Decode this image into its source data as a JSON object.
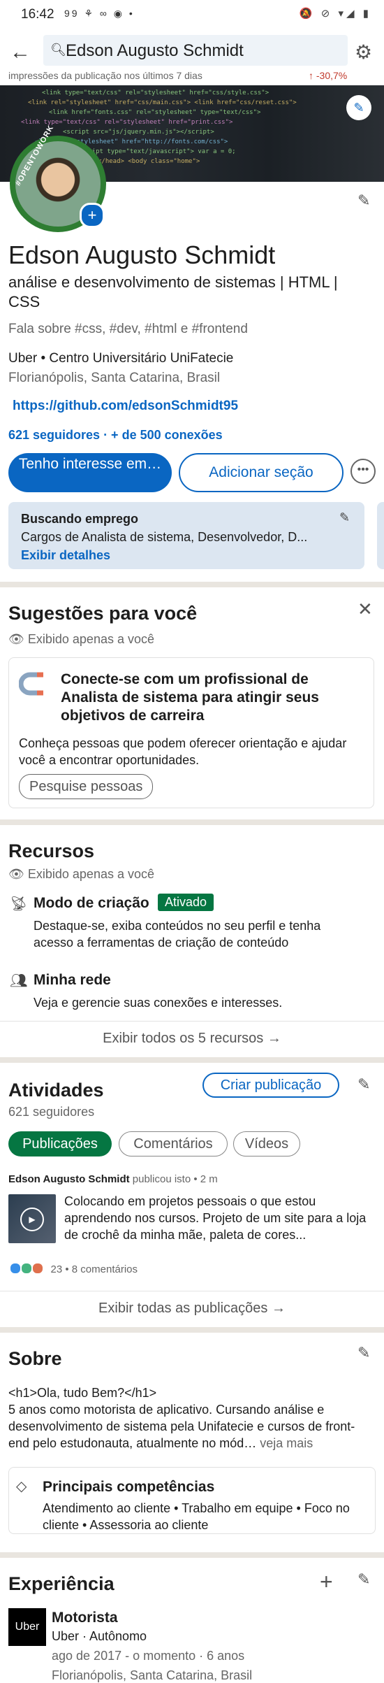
{
  "status_bar": {
    "time": "16:42",
    "left_icons": "99 ⚘ ∞ ◉ •",
    "right_icons": "🔕 ⊘ ▾◢ ▮"
  },
  "search": {
    "query": "Edson Augusto Schmidt"
  },
  "banner": {
    "cut_text": "impressões da publicação nos últimos 7 dias",
    "cut_pct": "↑ -30,7%"
  },
  "profile": {
    "open_to_work_label": "#OPENTOWORK",
    "name": "Edson Augusto Schmidt",
    "headline": "análise e desenvolvimento de sistemas | HTML | CSS",
    "talks_about": "Fala sobre #css, #dev, #html e #frontend",
    "company": "Uber • Centro Universitário UniFatecie",
    "location": "Florianópolis, Santa Catarina, Brasil",
    "link": "https://github.com/edsonSchmidt95",
    "followers": "621 seguidores · + de 500 conexões",
    "btn_interest": "Tenho interesse em…",
    "btn_add_section": "Adicionar seção",
    "btn_more": "•••"
  },
  "open_to_work_card": {
    "title": "Buscando emprego",
    "desc": "Cargos de Analista de sistema, Desenvolvedor, D...",
    "link": "Exibir detalhes"
  },
  "suggestions": {
    "title": "Sugestões para você",
    "private": "Exibido apenas a você",
    "card_title": "Conecte-se com um profissional de Analista de sistema para atingir seus objetivos de carreira",
    "card_desc": "Conheça pessoas que podem oferecer orientação e ajudar você a encontrar oportunidades.",
    "card_btn": "Pesquise pessoas"
  },
  "resources": {
    "title": "Recursos",
    "private": "Exibido apenas a você",
    "items": [
      {
        "title": "Modo de criação",
        "badge": "Ativado",
        "desc": "Destaque-se, exiba conteúdos no seu perfil e tenha acesso a ferramentas de criação de conteúdo"
      },
      {
        "title": "Minha rede",
        "desc": "Veja e gerencie suas conexões e interesses."
      }
    ],
    "show_all": "Exibir todos os 5 recursos →"
  },
  "activity": {
    "title": "Atividades",
    "followers": "621 seguidores",
    "create_post": "Criar publicação",
    "chips": [
      "Publicações",
      "Comentários",
      "Vídeos"
    ],
    "post_author": "Edson Augusto Schmidt",
    "post_meta": "publicou isto • 2 m",
    "post_text": "Colocando em projetos pessoais o que  estou aprendendo nos cursos. Projeto de um site para a loja de crochê da minha mãe, paleta de cores...",
    "reactions": "23 • 8 comentários",
    "show_all": "Exibir todas as publicações →"
  },
  "about": {
    "title": "Sobre",
    "text": "<h1>Ola, tudo Bem?</h1>\n5 anos como motorista de aplicativo. Cursando análise e desenvolvimento de sistema pela Unifatecie e cursos de front-end pelo estudonauta, atualmente no mód…",
    "more": "veja mais",
    "skills_title": "Principais competências",
    "skills": "Atendimento ao cliente • Trabalho em equipe • Foco no cliente • Assessoria ao cliente"
  },
  "experience": {
    "title": "Experiência",
    "logo_text": "Uber",
    "job_title": "Motorista",
    "company": "Uber · Autônomo",
    "dates": "ago de 2017 - o momento · 6 anos",
    "location": "Florianópolis, Santa Catarina, Brasil"
  },
  "colors": {
    "primary": "#0a66c2",
    "green": "#057642",
    "card": "#dce6f1",
    "separator": "#e9e5df"
  }
}
